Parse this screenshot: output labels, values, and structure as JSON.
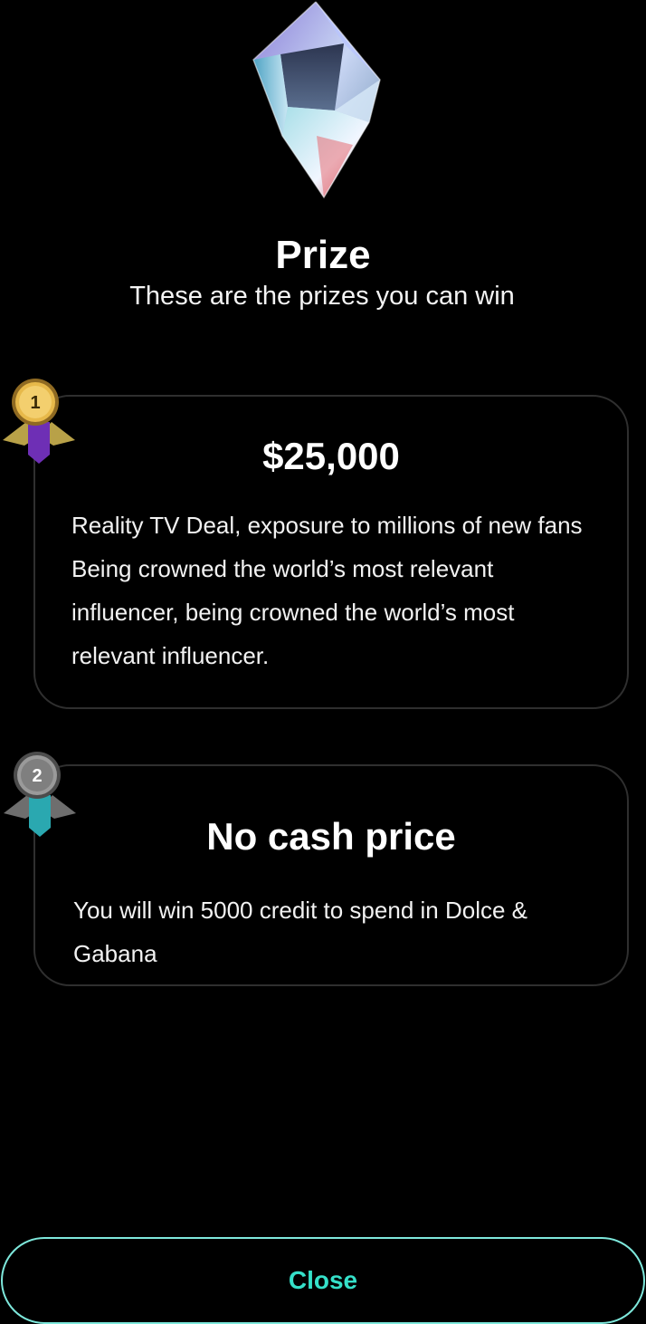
{
  "header": {
    "title": "Prize",
    "subtitle": "These are the prizes you can win",
    "icon": "crystal-gem-icon"
  },
  "prizes": [
    {
      "rank": "1",
      "medal_icon": "gold-medal-icon",
      "medal_colors": {
        "medal": "#e7b94a",
        "ribbon": "#6e2fb5",
        "wings": "#b8a148"
      },
      "title": "$25,000",
      "description": "Reality TV Deal, exposure to millions of new fans Being crowned the world’s most relevant influencer, being crowned the world’s most relevant influencer."
    },
    {
      "rank": "2",
      "medal_icon": "silver-medal-icon",
      "medal_colors": {
        "medal": "#9a9a9a",
        "ribbon": "#2aa8b0",
        "wings": "#6e6e6e"
      },
      "title": "No cash price",
      "description": "You will win 5000 credit to spend  in Dolce & Gabana"
    }
  ],
  "close_button": {
    "label": "Close",
    "color": "#35e0c9",
    "border_color": "#7ee8dc"
  },
  "colors": {
    "background": "#000000",
    "text": "#ffffff",
    "card_border": "#2f2f2f"
  }
}
